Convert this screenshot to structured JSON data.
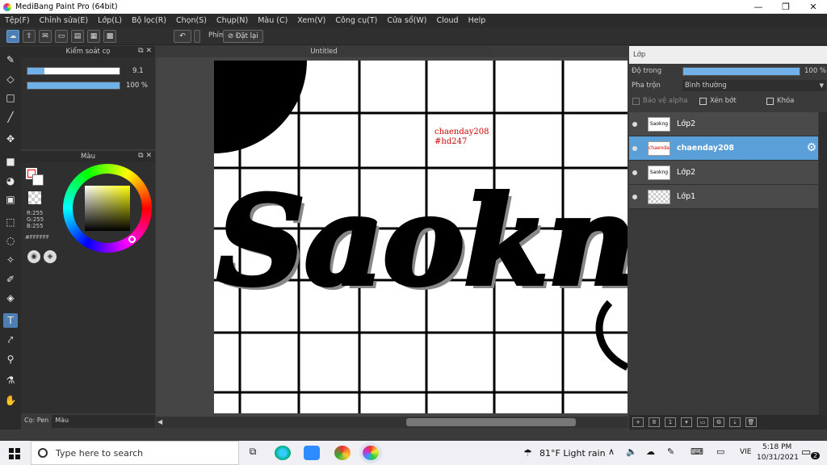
{
  "window": {
    "title": "MediBang Paint Pro (64bit)",
    "controls": [
      "—",
      "❐",
      "✕"
    ]
  },
  "menu": [
    "Tệp(F)",
    "Chỉnh sửa(E)",
    "Lớp(L)",
    "Bộ lọc(R)",
    "Chọn(S)",
    "Chụp(N)",
    "Màu (C)",
    "Xem(V)",
    "Công cụ(T)",
    "Cửa sổ(W)",
    "Cloud",
    "Help"
  ],
  "toolbar": {
    "phim_label": "Phím",
    "reset_label": "Đặt lại"
  },
  "brush_panel": {
    "title": "Kiểm soát cọ",
    "size_value": "9.1",
    "opacity_value": "100 %",
    "size_fraction": 0.18,
    "opacity_fraction": 1.0
  },
  "color_panel": {
    "title": "Màu",
    "r": "R:255",
    "g": "G:255",
    "b": "B:255",
    "hex": "#FFFFFF",
    "primary_color": "#ff0000"
  },
  "left_tabs": [
    "Cọ: Pen",
    "Màu"
  ],
  "canvas": {
    "tab_title": "Untitled",
    "annotation_line1": "chaenday208",
    "annotation_line2": "#hd247",
    "artwork_text": "Saokng"
  },
  "layer_panel": {
    "title": "Lớp",
    "opacity_label": "Độ trong",
    "opacity_value": "100 %",
    "blend_label": "Pha trộn",
    "blend_value": "Bình thường",
    "protect_alpha": "Bảo vệ alpha",
    "clip": "Xén bớt",
    "lock": "Khóa",
    "layers": [
      {
        "name": "Lớp2",
        "thumb": "Saokng",
        "selected": false
      },
      {
        "name": "chaenday208",
        "thumb": "chaenday208",
        "selected": true
      },
      {
        "name": "Lớp2",
        "thumb": "Saokng",
        "selected": false
      },
      {
        "name": "Lớp1",
        "thumb": "",
        "selected": false
      }
    ]
  },
  "taskbar": {
    "search_placeholder": "Type here to search",
    "weather": "81°F  Light rain",
    "lang": "VIE",
    "time": "5:18 PM",
    "date": "10/31/2021",
    "notifications": "2"
  }
}
